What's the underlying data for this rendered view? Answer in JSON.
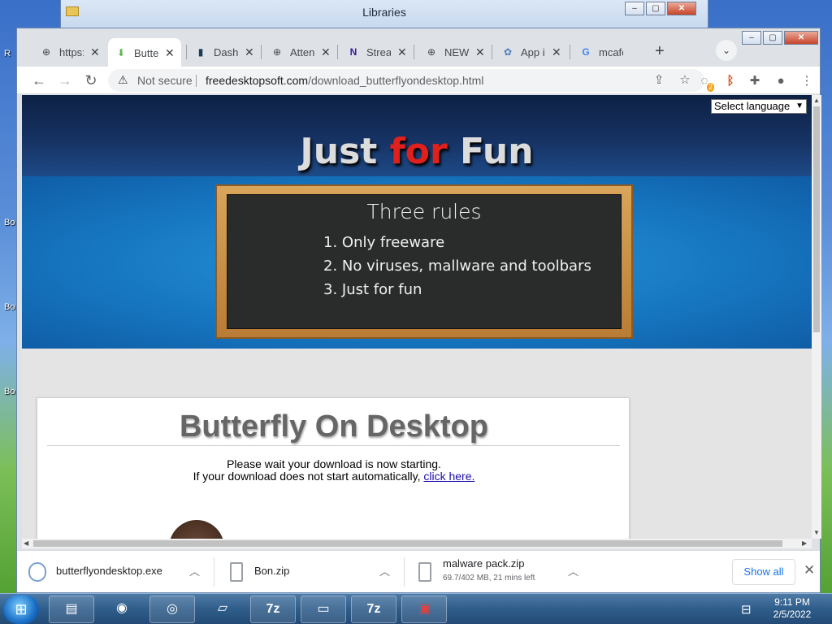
{
  "desktop": {
    "labels": [
      "R",
      "Bo",
      "Bo",
      "Bo"
    ]
  },
  "explorer": {
    "title": "Libraries",
    "buttons": {
      "minimize": "–",
      "maximize": "▢",
      "close": "✕"
    }
  },
  "browser": {
    "window_buttons": {
      "minimize": "–",
      "maximize": "▢",
      "close": "✕"
    },
    "tabs": [
      {
        "label": "https:",
        "icon": "globe-icon",
        "glyph": "⊕",
        "active": false
      },
      {
        "label": "Butte",
        "icon": "download-icon",
        "glyph": "⬇",
        "active": true
      },
      {
        "label": "Dashb",
        "icon": "dashboard-icon",
        "glyph": "▮",
        "active": false
      },
      {
        "label": "Atten",
        "icon": "globe-icon",
        "glyph": "⊕",
        "active": false
      },
      {
        "label": "Strea",
        "icon": "n-logo-icon",
        "glyph": "N",
        "active": false
      },
      {
        "label": "NEWS",
        "icon": "globe-icon",
        "glyph": "⊕",
        "active": false
      },
      {
        "label": "App i",
        "icon": "app-icon",
        "glyph": "✿",
        "active": false
      },
      {
        "label": "mcafe",
        "icon": "google-icon",
        "glyph": "G",
        "active": false
      }
    ],
    "tab_close_glyph": "✕",
    "new_tab_glyph": "+",
    "tab_search_glyph": "⌄",
    "security_label": "Not secure",
    "url_domain": "freedesktopsoft.com",
    "url_path": "/download_butterflyondesktop.html",
    "extension_badge": "2"
  },
  "page": {
    "language_select": "Select language",
    "banner": {
      "title_a": "Just ",
      "title_b": "for",
      "title_c": " Fun"
    },
    "board": {
      "heading": "Three rules",
      "rules": [
        "1. Only freeware",
        "2. No viruses, mallware and toolbars",
        "3. Just for fun"
      ]
    },
    "card": {
      "title": "Butterfly On Desktop",
      "line1": "Please wait your download is now starting.",
      "line2": "If your download does not start automatically, ",
      "link": "click here."
    }
  },
  "downloads": {
    "items": [
      {
        "name": "butterflyondesktop.exe",
        "status": ""
      },
      {
        "name": "Bon.zip",
        "status": ""
      },
      {
        "name": "malware pack.zip",
        "status": "69.7/402 MB, 21 mins left"
      }
    ],
    "show_all": "Show all",
    "close_glyph": "✕"
  },
  "taskbar": {
    "time": "9:11 PM",
    "date": "2/5/2022",
    "apps": [
      {
        "icon": "folder-icon",
        "glyph": "▤"
      },
      {
        "icon": "firefox-icon",
        "glyph": "◉"
      },
      {
        "icon": "chrome-icon",
        "glyph": "◎"
      },
      {
        "icon": "notepad-icon",
        "glyph": "▱"
      },
      {
        "icon": "7zip-icon",
        "glyph": "7z"
      },
      {
        "icon": "cmd-icon",
        "glyph": "▭"
      },
      {
        "icon": "7zip-icon",
        "glyph": "7z"
      },
      {
        "icon": "toolbox-icon",
        "glyph": "▣"
      }
    ]
  }
}
